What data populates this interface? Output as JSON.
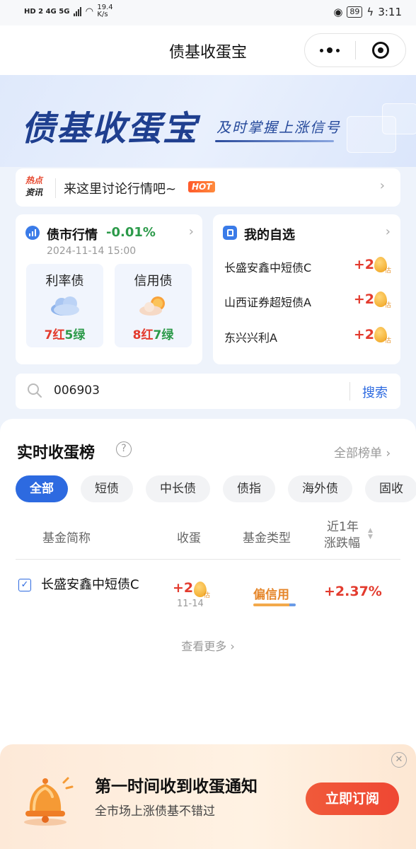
{
  "status_bar": {
    "left_icons": "HD 2 4G 5G",
    "net_speed": "19.4",
    "net_unit": "K/s",
    "battery": "89",
    "time": "3:11"
  },
  "nav": {
    "title": "债基收蛋宝"
  },
  "banner": {
    "brand": "债基收蛋宝",
    "slogan": "及时掌握上涨信号"
  },
  "news": {
    "tag_line1": "热点",
    "tag_line2": "资讯",
    "text": "来这里讨论行情吧~",
    "badge": "HOT"
  },
  "market": {
    "title": "债市行情",
    "change": "-0.01%",
    "datetime": "2024-11-14 15:00",
    "categories": [
      {
        "name": "利率债",
        "red": "7红",
        "green": "5绿",
        "weather": "cloudy"
      },
      {
        "name": "信用债",
        "red": "8红",
        "green": "7绿",
        "weather": "partly-sunny"
      }
    ]
  },
  "watchlist": {
    "title": "我的自选",
    "items": [
      {
        "name": "长盛安鑫中短债C",
        "change": "+2",
        "egg_label": "估"
      },
      {
        "name": "山西证券超短债A",
        "change": "+2",
        "egg_label": "估"
      },
      {
        "name": "东兴兴利A",
        "change": "+2",
        "egg_label": "估"
      }
    ]
  },
  "search": {
    "value": "006903",
    "button": "搜索"
  },
  "ranking": {
    "title": "实时收蛋榜",
    "help": "?",
    "all_link": "全部榜单",
    "tabs": [
      "全部",
      "短债",
      "中长债",
      "债指",
      "海外债",
      "固收"
    ],
    "headers": {
      "name": "基金简称",
      "eggs": "收蛋",
      "type": "基金类型",
      "change_line1": "近1年",
      "change_line2": "涨跌幅"
    },
    "rows": [
      {
        "name": "长盛安鑫中短债C",
        "eggs": "+2",
        "egg_label": "估",
        "date": "11-14",
        "type": "偏信用",
        "change": "+2.37%"
      }
    ],
    "more": "查看更多"
  },
  "promo": {
    "title": "第一时间收到收蛋通知",
    "subtitle": "全市场上涨债基不错过",
    "button": "立即订阅",
    "close": "✕"
  },
  "colors": {
    "accent": "#2d6ae0",
    "up": "#e33b2e",
    "down": "#2c9a4a",
    "brand": "#1f3f8f"
  }
}
